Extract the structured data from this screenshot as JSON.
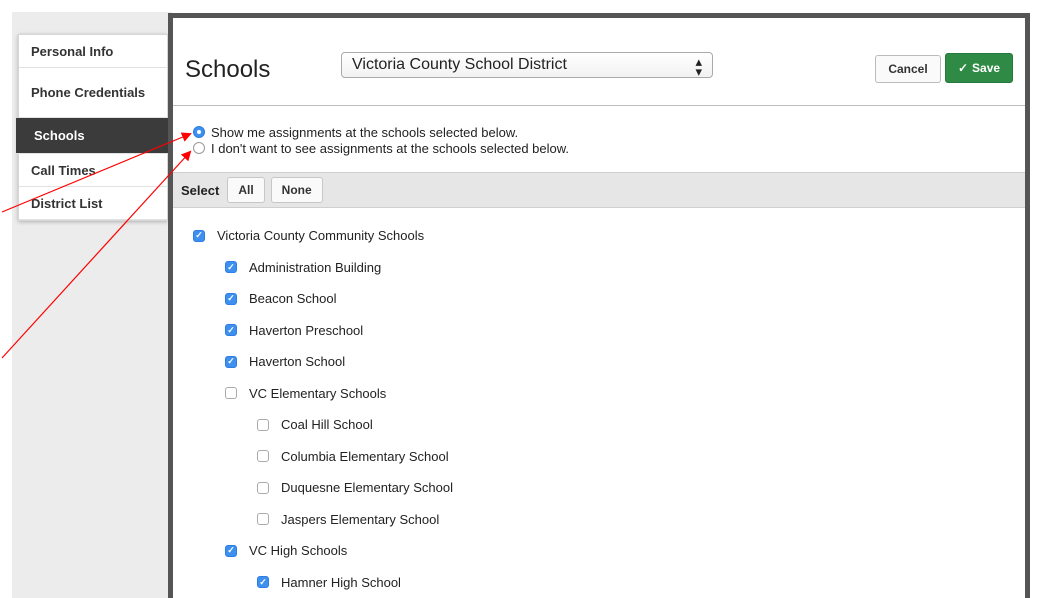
{
  "sidebar": {
    "items": [
      {
        "label": "Personal Info"
      },
      {
        "label": "Phone Credentials"
      },
      {
        "label": "Schools"
      },
      {
        "label": "Call Times"
      },
      {
        "label": "District List"
      }
    ]
  },
  "header": {
    "title": "Schools",
    "district_select": "Victoria County School District",
    "cancel_label": "Cancel",
    "save_label": "Save"
  },
  "options": {
    "show": "Show me assignments at the schools selected below.",
    "hide": "I don't want to see assignments at the schools selected below.",
    "selected": "show"
  },
  "selectbar": {
    "label": "Select",
    "all": "All",
    "none": "None"
  },
  "tree": [
    {
      "label": "Victoria County Community Schools",
      "level": 0,
      "checked": true
    },
    {
      "label": "Administration Building",
      "level": 1,
      "checked": true
    },
    {
      "label": "Beacon School",
      "level": 1,
      "checked": true
    },
    {
      "label": "Haverton Preschool",
      "level": 1,
      "checked": true
    },
    {
      "label": "Haverton School",
      "level": 1,
      "checked": true
    },
    {
      "label": "VC Elementary Schools",
      "level": 1,
      "checked": false
    },
    {
      "label": "Coal Hill School",
      "level": 2,
      "checked": false
    },
    {
      "label": "Columbia Elementary School",
      "level": 2,
      "checked": false
    },
    {
      "label": "Duquesne Elementary School",
      "level": 2,
      "checked": false
    },
    {
      "label": "Jaspers Elementary School",
      "level": 2,
      "checked": false
    },
    {
      "label": "VC High Schools",
      "level": 1,
      "checked": true
    },
    {
      "label": "Hamner High School",
      "level": 2,
      "checked": true
    }
  ],
  "colors": {
    "accent": "#3d8ff0",
    "save": "#2f8a45",
    "annotation": "#ff0000"
  }
}
